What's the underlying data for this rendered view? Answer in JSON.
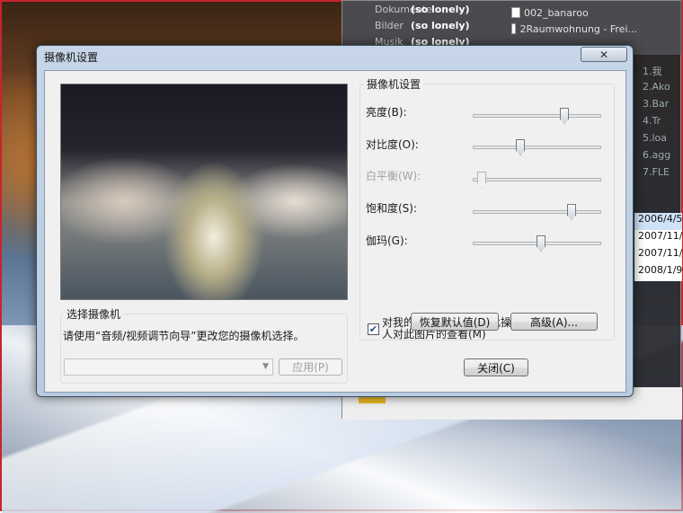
{
  "background_window": {
    "folders": [
      {
        "name": "Dokumente",
        "tag": "(so lonely)"
      },
      {
        "name": "Bilder",
        "tag": "(so lonely)"
      },
      {
        "name": "Musik",
        "tag": "(so lonely)"
      }
    ],
    "files": [
      "002_banaroo",
      "2Raumwohnung - Frei..."
    ],
    "list_items": [
      "1.我",
      "2.Ako",
      "3.Bar",
      "4.Tr",
      "5.loa",
      "6.agg",
      "7.FLE"
    ],
    "dates": [
      "2006/4/5",
      "2007/11/",
      "2007/11/",
      "2008/1/9"
    ]
  },
  "dialog": {
    "title": "摄像机设置",
    "close_glyph": "✕",
    "select_camera": {
      "group_label": "选择摄像机",
      "hint": "请使用“音频/视频调节向导”更改您的摄像机选择。",
      "combo_value": "",
      "apply_label": "应用(P)"
    },
    "settings": {
      "group_label": "摄像机设置",
      "sliders": [
        {
          "label": "亮度(B):",
          "value": 0.72,
          "enabled": true
        },
        {
          "label": "对比度(O):",
          "value": 0.35,
          "enabled": true
        },
        {
          "label": "白平衡(W):",
          "value": 0.03,
          "enabled": false
        },
        {
          "label": "饱和度(S):",
          "value": 0.78,
          "enabled": true
        },
        {
          "label": "伽玛(G):",
          "value": 0.53,
          "enabled": true
        }
      ],
      "mirror_checked": true,
      "mirror_label": "对我的图片进行镜像，此操作不会影响其他人对此图片的查看(M)",
      "restore_label": "恢复默认值(D)",
      "advanced_label": "高级(A)..."
    },
    "close_label": "关闭(C)"
  }
}
